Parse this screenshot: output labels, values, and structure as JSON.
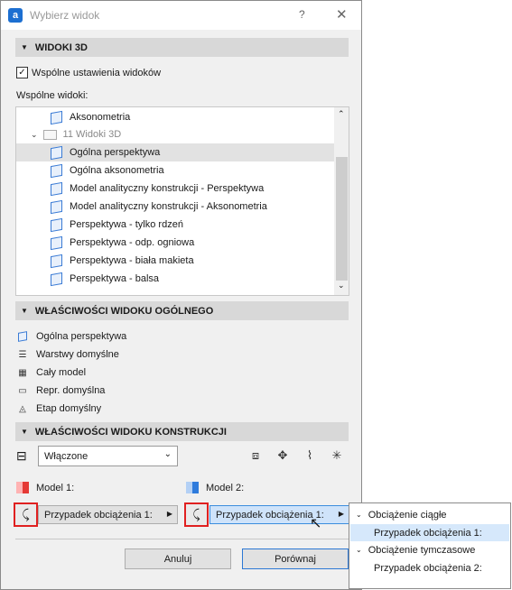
{
  "dialog": {
    "title": "Wybierz widok",
    "help": "?",
    "close": "✕"
  },
  "section_3d": {
    "title": "WIDOKI 3D",
    "common_settings_label": "Wspólne ustawienia widoków",
    "common_settings_checked": true,
    "common_views_label": "Wspólne widoki:"
  },
  "tree": {
    "items": [
      {
        "label": "Aksonometria",
        "type": "view"
      },
      {
        "label": "11 Widoki 3D",
        "type": "folder"
      },
      {
        "label": "Ogólna perspektywa",
        "type": "view",
        "selected": true
      },
      {
        "label": "Ogólna aksonometria",
        "type": "view"
      },
      {
        "label": "Model analityczny konstrukcji - Perspektywa",
        "type": "view"
      },
      {
        "label": "Model analityczny konstrukcji - Aksonometria",
        "type": "view"
      },
      {
        "label": "Perspektywa - tylko rdzeń",
        "type": "view"
      },
      {
        "label": "Perspektywa - odp. ogniowa",
        "type": "view"
      },
      {
        "label": "Perspektywa - biała makieta",
        "type": "view"
      },
      {
        "label": "Perspektywa - balsa",
        "type": "view"
      }
    ]
  },
  "section_general": {
    "title": "WŁAŚCIWOŚCI WIDOKU OGÓLNEGO",
    "props": [
      {
        "label": "Ogólna perspektywa",
        "icon": "perspective-icon"
      },
      {
        "label": "Warstwy domyślne",
        "icon": "layers-icon"
      },
      {
        "label": "Cały model",
        "icon": "model-icon"
      },
      {
        "label": "Repr. domyślna",
        "icon": "representation-icon"
      },
      {
        "label": "Etap domyślny",
        "icon": "phase-icon"
      }
    ]
  },
  "section_structure": {
    "title": "WŁAŚCIWOŚCI WIDOKU KONSTRUKCJI",
    "select_value": "Włączone",
    "model1_label": "Model 1:",
    "model2_label": "Model 2:",
    "model1_color": "#e53935",
    "model2_color": "#2f7bdc",
    "model1_case": "Przypadek obciążenia 1:",
    "model2_case": "Przypadek obciążenia 1:"
  },
  "buttons": {
    "cancel": "Anuluj",
    "compare": "Porównaj"
  },
  "popup": {
    "items": [
      {
        "label": "Obciążenie ciągłe",
        "type": "group"
      },
      {
        "label": "Przypadek obciążenia 1:",
        "type": "item",
        "selected": true
      },
      {
        "label": "Obciążenie tymczasowe",
        "type": "group"
      },
      {
        "label": "Przypadek obciążenia 2:",
        "type": "item"
      }
    ]
  }
}
